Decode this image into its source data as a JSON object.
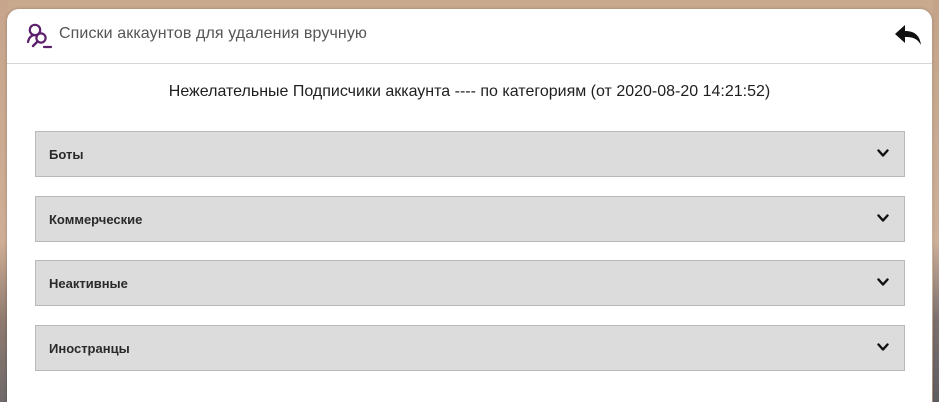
{
  "header": {
    "title": "Списки аккаунтов для удаления вручную",
    "logo_icon": "user-search-icon",
    "back_icon": "back-arrow-icon"
  },
  "main": {
    "subtitle": "Нежелательные Подписчики аккаунта ---- по категориям (от 2020-08-20 14:21:52)",
    "categories": [
      {
        "label": "Боты",
        "icon": "chevron-down-icon"
      },
      {
        "label": "Коммерческие",
        "icon": "chevron-down-icon"
      },
      {
        "label": "Неактивные",
        "icon": "chevron-down-icon"
      },
      {
        "label": "Иностранцы",
        "icon": "chevron-down-icon"
      }
    ]
  },
  "colors": {
    "accent": "#5b1f6b",
    "accordion_bg": "#dcdcdc",
    "accordion_border": "#b9b9b9"
  }
}
